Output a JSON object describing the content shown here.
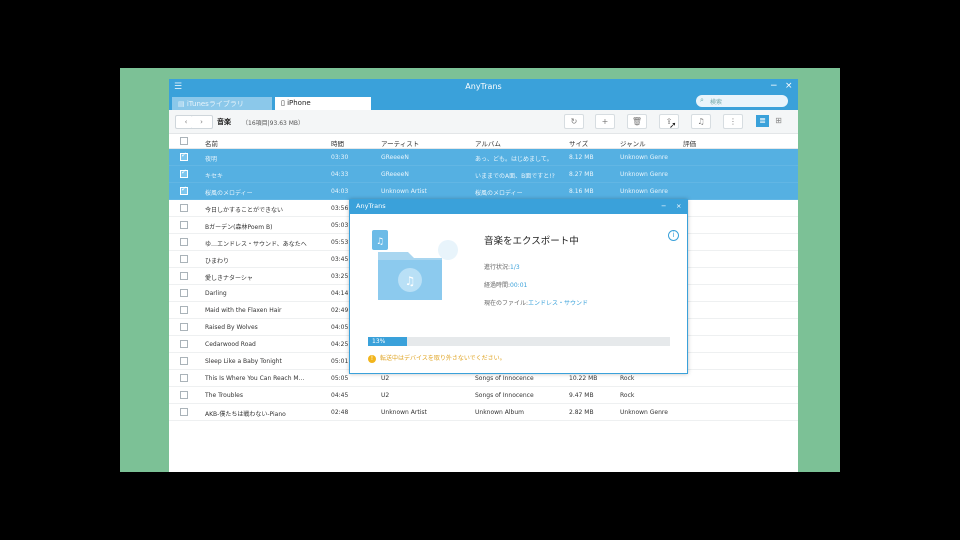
{
  "app": {
    "title": "AnyTrans",
    "menu_icon": "menu-icon",
    "window_controls": [
      "−",
      "×"
    ]
  },
  "tabs": [
    {
      "label": "iTunesライブラリ",
      "icon": "library-icon",
      "active": false
    },
    {
      "label": "iPhone",
      "icon": "phone-icon",
      "active": true
    }
  ],
  "search": {
    "placeholder": "検索",
    "icon": "search-icon"
  },
  "toolbar": {
    "back": "‹",
    "forward": "›",
    "title": "音楽",
    "count": "（16項目|93.63 MB）",
    "buttons": [
      {
        "icon": "refresh-icon",
        "glyph": "↻"
      },
      {
        "icon": "add-icon",
        "glyph": "+"
      },
      {
        "icon": "delete-icon",
        "glyph": "🗑"
      },
      {
        "icon": "export-to-pc-icon",
        "glyph": "⇪"
      },
      {
        "icon": "export-to-itunes-icon",
        "glyph": "♫"
      },
      {
        "icon": "more-icon",
        "glyph": "⋮"
      }
    ],
    "view_list": "≣",
    "view_grid": "⊞"
  },
  "table": {
    "headers": [
      "名前",
      "時間",
      "アーティスト",
      "アルバム",
      "サイズ",
      "ジャンル",
      "評価"
    ],
    "rows": [
      {
        "name": "夜明",
        "time": "03:30",
        "artist": "GReeeeN",
        "album": "あっ、ども。はじめまして。",
        "size": "8.12 MB",
        "genre": "Unknown Genre",
        "selected": true
      },
      {
        "name": "キセキ",
        "time": "04:33",
        "artist": "GReeeeN",
        "album": "いままでのA面、B面ですと!?",
        "size": "8.27 MB",
        "genre": "Unknown Genre",
        "selected": true
      },
      {
        "name": "桜風のメロディー",
        "time": "04:03",
        "artist": "Unknown Artist",
        "album": "桜風のメロディー",
        "size": "8.16 MB",
        "genre": "Unknown Genre",
        "selected": true
      },
      {
        "name": "今日しかすることができない",
        "time": "03:56",
        "artist": "",
        "album": "",
        "size": "",
        "genre": "",
        "selected": false
      },
      {
        "name": "Bガーデン(森林Poem B)",
        "time": "05:03",
        "artist": "",
        "album": "",
        "size": "",
        "genre": "",
        "selected": false
      },
      {
        "name": "ゆ…エンドレス・サウンド、あなたへ",
        "time": "05:53",
        "artist": "",
        "album": "",
        "size": "",
        "genre": "",
        "selected": false
      },
      {
        "name": "ひまわり",
        "time": "03:45",
        "artist": "",
        "album": "",
        "size": "",
        "genre": "",
        "selected": false
      },
      {
        "name": "愛しきナターシャ",
        "time": "03:25",
        "artist": "",
        "album": "",
        "size": "",
        "genre": "",
        "selected": false
      },
      {
        "name": "Darling",
        "time": "04:14",
        "artist": "",
        "album": "",
        "size": "",
        "genre": "",
        "selected": false
      },
      {
        "name": "Maid with the Flaxen Hair",
        "time": "02:49",
        "artist": "",
        "album": "",
        "size": "",
        "genre": "",
        "selected": false
      },
      {
        "name": "Raised By Wolves",
        "time": "04:05",
        "artist": "",
        "album": "",
        "size": "",
        "genre": "",
        "selected": false
      },
      {
        "name": "Cedarwood Road",
        "time": "04:25",
        "artist": "",
        "album": "",
        "size": "",
        "genre": "",
        "selected": false
      },
      {
        "name": "Sleep Like a Baby Tonight",
        "time": "05:01",
        "artist": "",
        "album": "",
        "size": "",
        "genre": "",
        "selected": false
      },
      {
        "name": "This Is Where You Can Reach M...",
        "time": "05:05",
        "artist": "U2",
        "album": "Songs of Innocence",
        "size": "10.22 MB",
        "genre": "Rock",
        "selected": false
      },
      {
        "name": "The Troubles",
        "time": "04:45",
        "artist": "U2",
        "album": "Songs of Innocence",
        "size": "9.47 MB",
        "genre": "Rock",
        "selected": false
      },
      {
        "name": "AKB-僕たちは戦わない-Piano",
        "time": "02:48",
        "artist": "Unknown Artist",
        "album": "Unknown Album",
        "size": "2.82 MB",
        "genre": "Unknown Genre",
        "selected": false
      }
    ]
  },
  "dialog": {
    "title": "AnyTrans",
    "heading": "音楽をエクスポート中",
    "info_icon": "info-icon",
    "art_icon": "music-folder-icon",
    "lines": [
      {
        "label": "進行状況:",
        "value": "1/3"
      },
      {
        "label": "経過時間:",
        "value": "00:01"
      },
      {
        "label": "現在のファイル:",
        "value": "エンドレス・サウンド"
      }
    ],
    "progress_percent": 13,
    "progress_text": "13%",
    "warning_icon": "warning-icon",
    "warning": "転送中はデバイスを取り外さないでください。",
    "accent": "#3aa1da",
    "warning_color": "#e0a423"
  },
  "colors": {
    "window_blue": "#3aa1da",
    "selected_row": "#55b0e2",
    "desktop_green": "#7cc196"
  }
}
